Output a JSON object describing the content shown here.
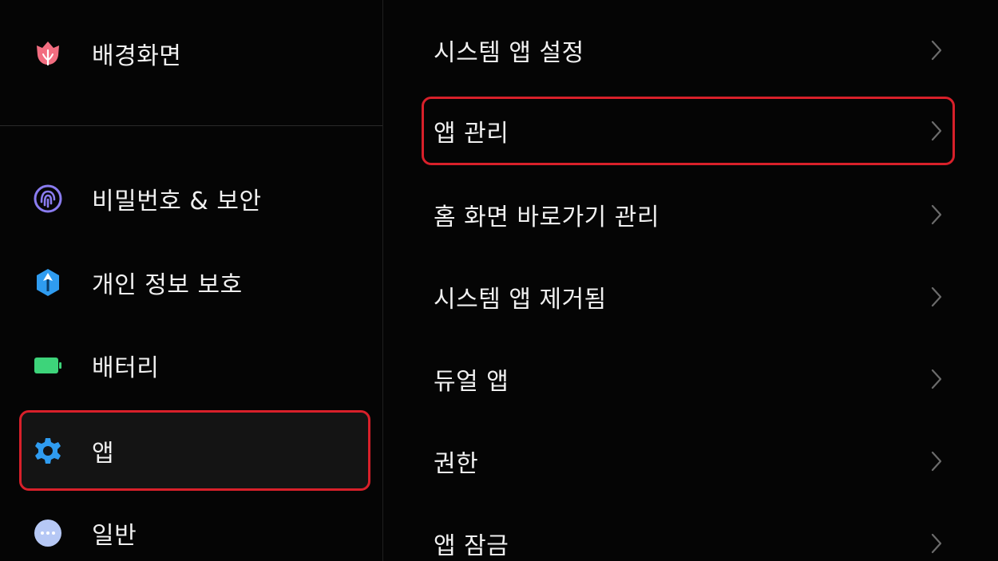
{
  "left_menu": {
    "items": [
      {
        "label": "배경화면",
        "icon": "tulip-icon",
        "color": "#f26d80"
      },
      {
        "label": "비밀번호 & 보안",
        "icon": "fingerprint-icon",
        "color": "#8a7cf0"
      },
      {
        "label": "개인 정보 보호",
        "icon": "privacy-shield-icon",
        "color": "#2f9cf0"
      },
      {
        "label": "배터리",
        "icon": "battery-icon",
        "color": "#3dd47a"
      },
      {
        "label": "앱",
        "icon": "gear-icon",
        "color": "#2f9cf0",
        "selected": true
      },
      {
        "label": "일반",
        "icon": "more-dots-icon",
        "color": "#b6c8f5"
      }
    ]
  },
  "right_menu": {
    "items": [
      {
        "label": "시스템 앱 설정"
      },
      {
        "label": "앱 관리",
        "highlighted": true
      },
      {
        "label": "홈 화면 바로가기 관리"
      },
      {
        "label": "시스템 앱 제거됨"
      },
      {
        "label": "듀얼 앱"
      },
      {
        "label": "권한"
      },
      {
        "label": "앱 잠금"
      }
    ]
  },
  "colors": {
    "background": "#050505",
    "highlight_border": "#d8202a",
    "chevron": "#6b6b6b"
  }
}
